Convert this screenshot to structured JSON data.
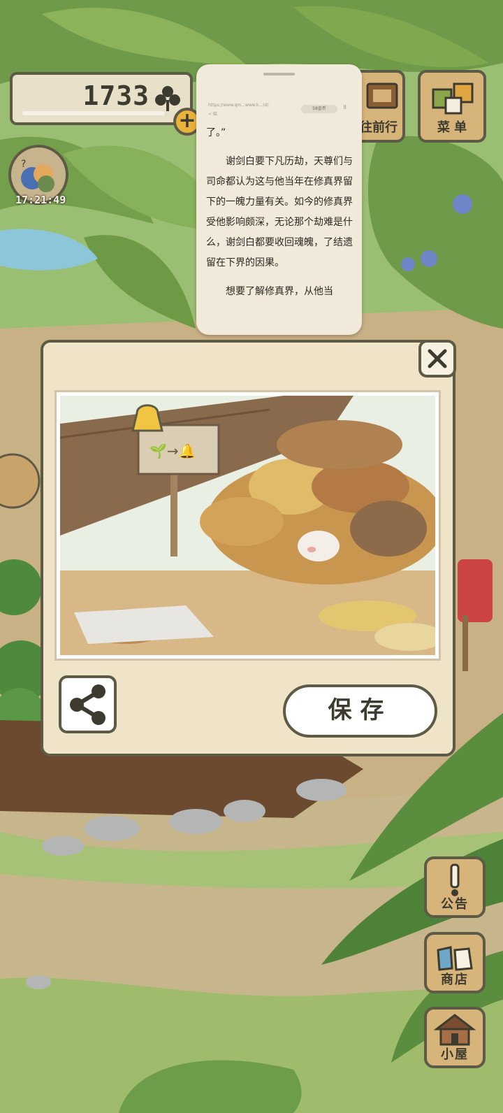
{
  "hud": {
    "clover_count": "1733",
    "timer": "17:21:49",
    "plus_label": "+"
  },
  "top_buttons": {
    "go_label": "往前行",
    "menu_label": "菜 单"
  },
  "reader": {
    "url_text": "https://www.qm...www.k...(d)",
    "small_text": "< 结",
    "badge_text": "58金币",
    "dots": "⠿",
    "lines": [
      "了。”",
      "谢剑白要下凡历劫，天尊们与司命都认为这与他当年在修真界留下的一魄力量有关。如今的修真界受他影响颇深，无论那个劫难是什么，谢剑白都要收回魂魄，了结遗留在下界的因果。",
      "想要了解修真界，从他当"
    ]
  },
  "dialog": {
    "save_label": "保存",
    "sign_text": "🌱→🔔"
  },
  "side_buttons": {
    "notice_label": "公告",
    "shop_label": "商店",
    "house_label": "小屋"
  },
  "colors": {
    "outline": "#5d5a45",
    "wood": "#d7b47a",
    "panel": "#efe4c8",
    "grass": "#8fb26a",
    "dirt": "#c9b186"
  }
}
